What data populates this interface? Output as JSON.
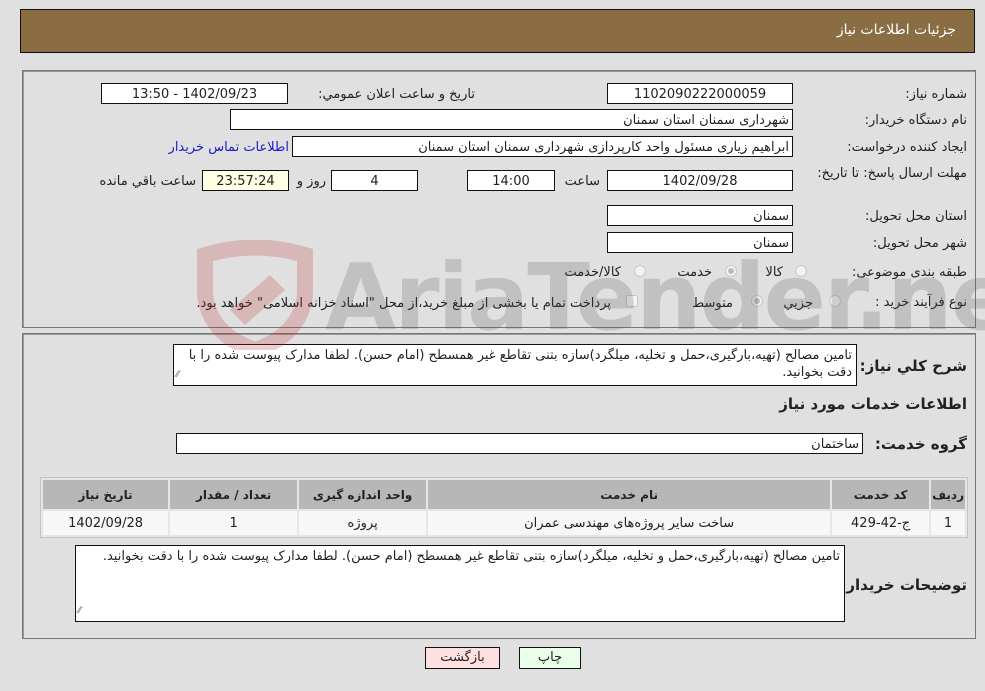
{
  "header": {
    "title": "جزئیات اطلاعات نیاز"
  },
  "form": {
    "need_number": {
      "label": "شماره نیاز:",
      "value": "1102090222000059"
    },
    "announce_datetime": {
      "label": "تاریخ و ساعت اعلان عمومي:",
      "value": "1402/09/23 - 13:50"
    },
    "buyer_org": {
      "label": "نام دستگاه خریدار:",
      "value": "شهرداری سمنان استان سمنان"
    },
    "requester": {
      "label": "ایجاد کننده درخواست:",
      "value": "ابراهیم زیاری مسئول واحد کارپردازی شهرداری سمنان استان سمنان"
    },
    "buyer_contact_link": "اطلاعات تماس خریدار",
    "deadline": {
      "label": "مهلت ارسال پاسخ: تا تاریخ:",
      "date": "1402/09/28",
      "time_label": "ساعت",
      "time": "14:00",
      "days": "4",
      "days_label": "روز و",
      "remaining": "23:57:24",
      "remaining_label": "ساعت باقي مانده"
    },
    "delivery_province": {
      "label": "استان محل تحویل:",
      "value": "سمنان"
    },
    "delivery_city": {
      "label": "شهر محل تحویل:",
      "value": "سمنان"
    },
    "category": {
      "label": "طبقه بندی موضوعی:",
      "options": [
        "کالا",
        "خدمت",
        "کالا/خدمت"
      ],
      "selected": "خدمت"
    },
    "purchase_type": {
      "label": "نوع فرآیند خرید :",
      "options": [
        "جزيي",
        "متوسط"
      ],
      "selected": "متوسط",
      "treasury_checkbox_label": "پرداخت تمام یا بخشی از مبلغ خرید،از محل \"اسناد خزانه اسلامی\" خواهد بود.",
      "treasury_checked": false
    }
  },
  "summary": {
    "label": "شرح کلي نیاز:",
    "text": "تامین مصالح (تهیه،بارگیری،حمل و تخلیه، میلگرد)سازه بتنی تقاطع غیر همسطح (امام حسن). لطفا مدارک پیوست شده را با دقت بخوانید."
  },
  "services": {
    "section_title": "اطلاعات خدمات مورد نیاز",
    "group_label": "گروه خدمت:",
    "group_value": "ساختمان",
    "table": {
      "headers": [
        "ردیف",
        "کد خدمت",
        "نام خدمت",
        "واحد اندازه گیری",
        "تعداد / مقدار",
        "تاریخ نیاز"
      ],
      "rows": [
        [
          "1",
          "ج-42-429",
          "ساخت سایر پروژه‌های مهندسی عمران",
          "پروژه",
          "1",
          "1402/09/28"
        ]
      ]
    }
  },
  "buyer_notes": {
    "label": "توضیحات خریدار:",
    "text": "تامین مصالح (تهیه،بارگیری،حمل و تخلیه، میلگرد)سازه بتنی تقاطع غیر همسطح (امام حسن). لطفا مدارک پیوست شده را با دقت بخوانید."
  },
  "buttons": {
    "print": "چاپ",
    "back": "بازگشت"
  },
  "watermark": {
    "text": "AriaTender.net"
  },
  "colors": {
    "header_bg": "#8b6d43",
    "print_bg": "#eaffea",
    "back_bg": "#ffe0e0",
    "link": "#1a1acc"
  }
}
